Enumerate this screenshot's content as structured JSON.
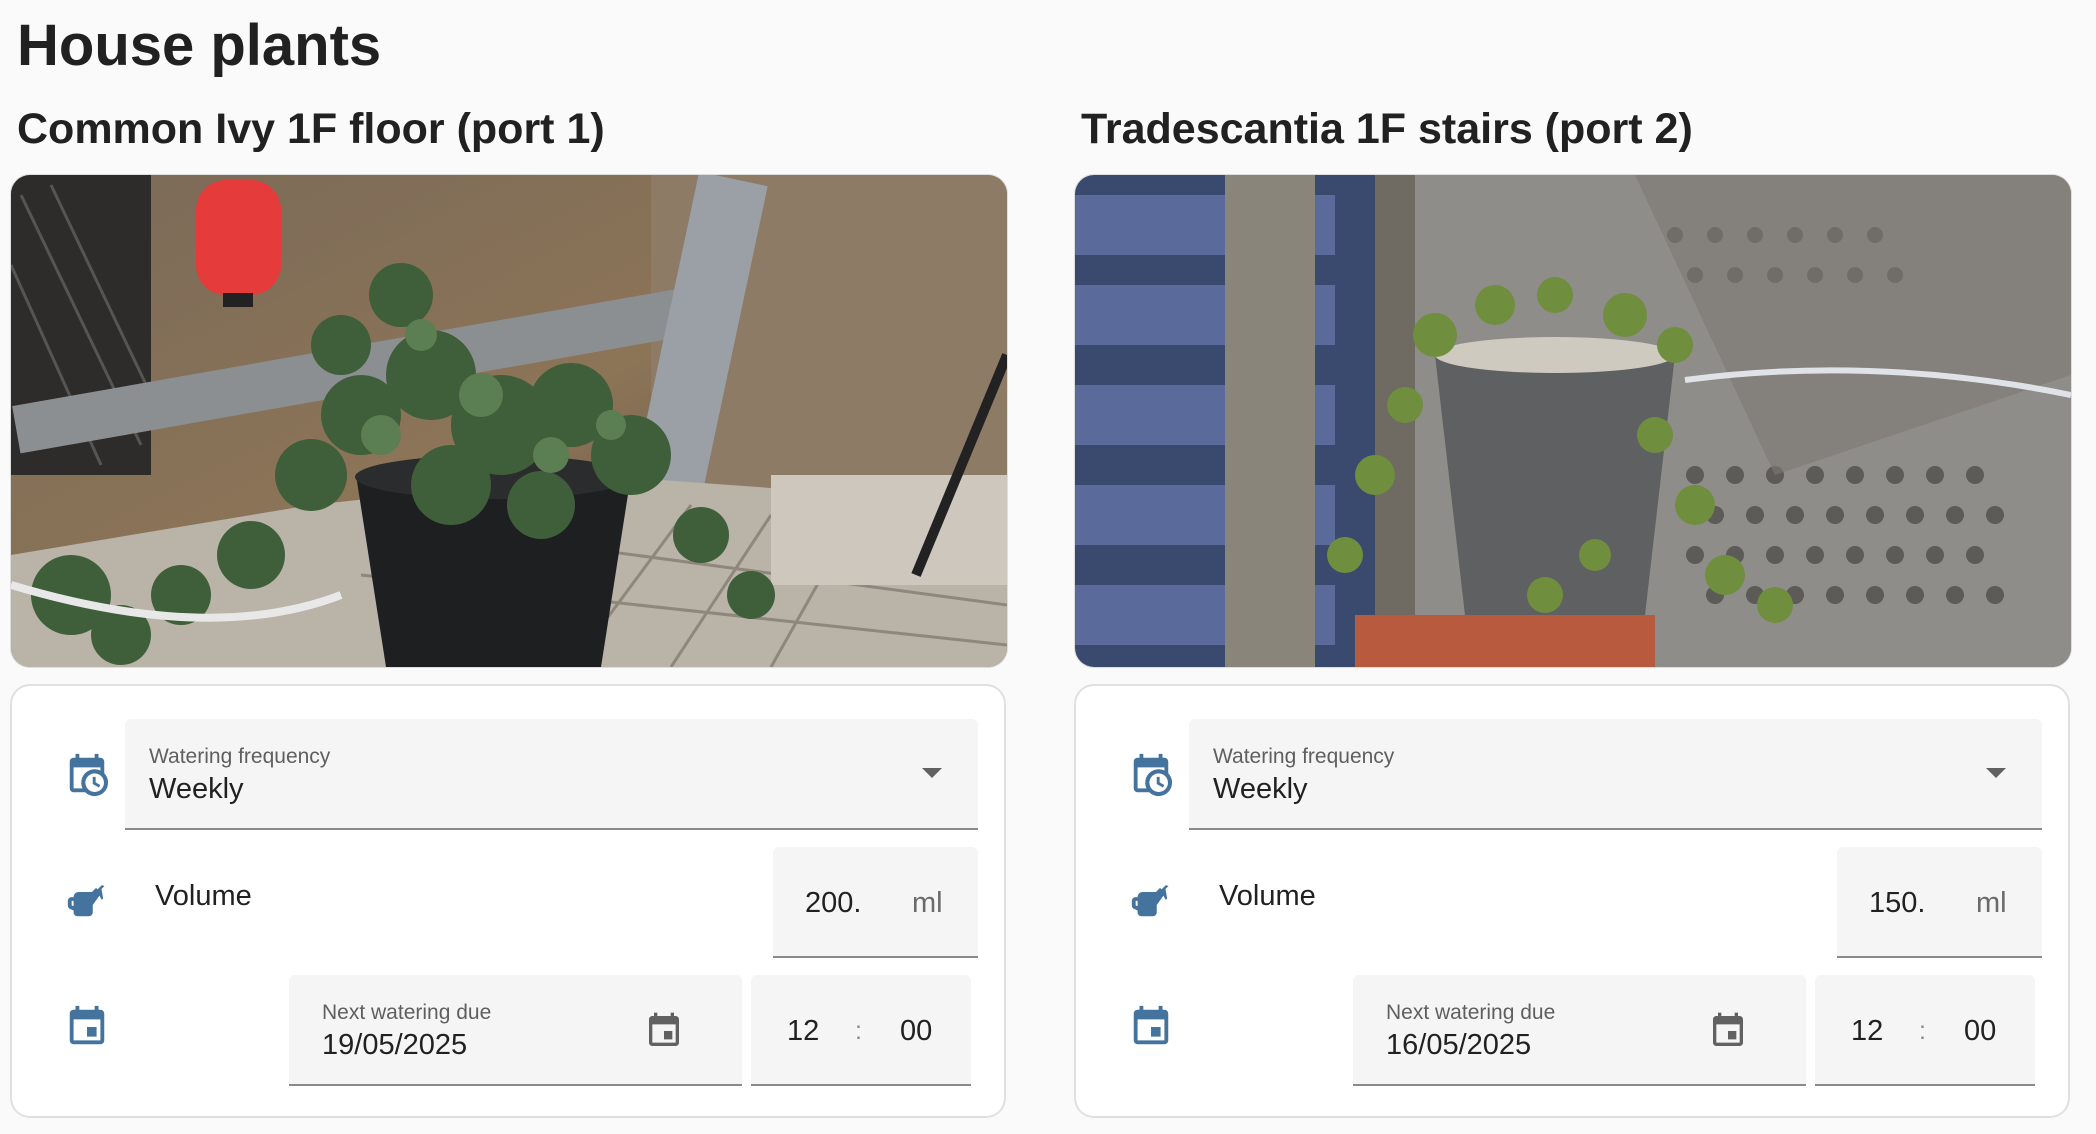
{
  "page": {
    "title": "House plants"
  },
  "colors": {
    "icon_blue": "#44739e",
    "field_bg": "#f5f5f5",
    "underline": "#8a8a8a"
  },
  "plants": [
    {
      "title": "Common Ivy 1F floor (port 1)",
      "frequency": {
        "label": "Watering frequency",
        "value": "Weekly",
        "icon": "calendar-clock-icon"
      },
      "volume": {
        "label": "Volume",
        "value": "200.",
        "unit": "ml",
        "icon": "watering-can-icon"
      },
      "next_watering": {
        "label": "Next watering due",
        "date": "19/05/2025",
        "hour": "12",
        "separator": ":",
        "minute": "00",
        "icon": "calendar-icon"
      }
    },
    {
      "title": "Tradescantia 1F stairs (port 2)",
      "frequency": {
        "label": "Watering frequency",
        "value": "Weekly",
        "icon": "calendar-clock-icon"
      },
      "volume": {
        "label": "Volume",
        "value": "150.",
        "unit": "ml",
        "icon": "watering-can-icon"
      },
      "next_watering": {
        "label": "Next watering due",
        "date": "16/05/2025",
        "hour": "12",
        "separator": ":",
        "minute": "00",
        "icon": "calendar-icon"
      }
    }
  ]
}
